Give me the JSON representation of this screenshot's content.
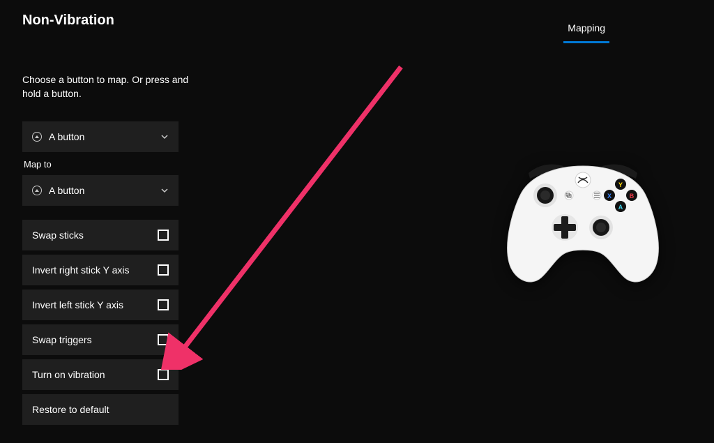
{
  "header": {
    "title": "Non-Vibration",
    "tabs": [
      {
        "label": "Mapping",
        "active": true
      }
    ]
  },
  "instruction_text": "Choose a button to map. Or press and hold a button.",
  "source_button": {
    "label": "A button"
  },
  "map_to_label": "Map to",
  "target_button": {
    "label": "A button"
  },
  "options": [
    {
      "label": "Swap sticks",
      "checked": false
    },
    {
      "label": "Invert right stick Y axis",
      "checked": false
    },
    {
      "label": "Invert left stick Y axis",
      "checked": false
    },
    {
      "label": "Swap triggers",
      "checked": false
    },
    {
      "label": "Turn on vibration",
      "checked": false
    }
  ],
  "restore_label": "Restore to default",
  "colors": {
    "background": "#0c0c0c",
    "panel": "#1f1f1f",
    "accent": "#0078d4",
    "arrow": "#ef3168"
  }
}
